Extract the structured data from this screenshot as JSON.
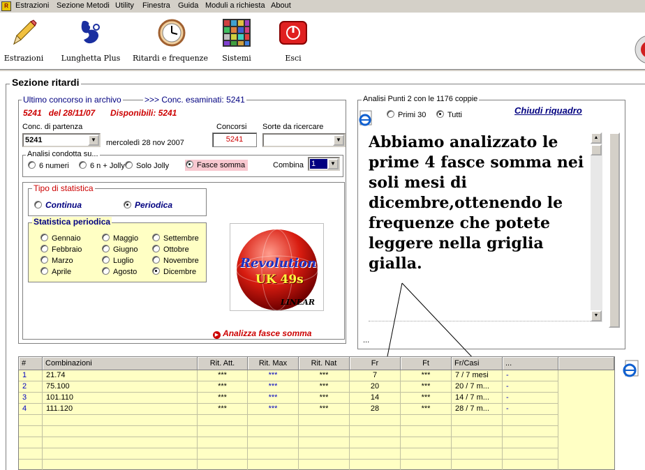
{
  "menu": [
    "Estrazioni",
    "Sezione Metodi",
    "Utility",
    "Finestra",
    "Guida",
    "Moduli a richiesta",
    "About"
  ],
  "toolbar": {
    "estrazioni": "Estrazioni",
    "lunghetta": "Lunghetta Plus",
    "ritardi": "Ritardi e frequenze",
    "sistemi": "Sistemi",
    "esci": "Esci"
  },
  "section_title": "Sezione ritardi",
  "archivio": {
    "title": "Ultimo concorso in archivo",
    "examined": ">>> Conc. esaminati: 5241",
    "last": "5241   del 28/11/07",
    "disponibili": "Disponibili: 5241",
    "conc_label": "Conc. di partenza",
    "conc_value": "5241",
    "conc_date": "mercoledì 28 nov 2007",
    "concorsi_label": "Concorsi",
    "concorsi_value": "5241",
    "sorte_label": "Sorte da ricercare",
    "sorte_value": ""
  },
  "analisi": {
    "title": "Analisi condotta su...",
    "options": [
      "6 numeri",
      "6 n + Jolly",
      "Solo Jolly",
      "Fasce somma"
    ],
    "selected_index": 3,
    "combina_label": "Combina",
    "combina_value": "1"
  },
  "tipo": {
    "title": "Tipo di statistica",
    "continua": "Continua",
    "periodica": "Periodica",
    "selected": "periodica"
  },
  "periodica": {
    "title": "Statistica periodica",
    "months": [
      "Gennaio",
      "Febbraio",
      "Marzo",
      "Aprile",
      "Maggio",
      "Giugno",
      "Luglio",
      "Agosto",
      "Settembre",
      "Ottobre",
      "Novembre",
      "Dicembre"
    ],
    "selected": "Dicembre"
  },
  "logo": {
    "line1": "Revolution",
    "line2": "UK 49s",
    "line3": "LINEAR"
  },
  "analizza_label": "Analizza fasce somma",
  "punti": {
    "title": "Analisi Punti 2 con le 1176 coppie",
    "primi": "Primi 30",
    "tutti": "Tutti",
    "selected": "tutti",
    "chiudi": "Chiudi riquadro",
    "message": "Abbiamo analizzato le prime 4 fasce somma nei soli mesi di dicembre,ottenendo le frequenze che potete leggere nella griglia gialla.",
    "ellipsis": "..."
  },
  "grid": {
    "headers": [
      "#",
      "Combinazioni",
      "Rit. Att.",
      "Rit. Max",
      "Rit. Nat",
      "Fr",
      "Ft",
      "Fr/Casi",
      "..."
    ],
    "rows": [
      [
        "1",
        "21.74",
        "***",
        "***",
        "***",
        "7",
        "***",
        "7 / 7 mesi",
        "-"
      ],
      [
        "2",
        "75.100",
        "***",
        "***",
        "***",
        "20",
        "***",
        "20 / 7 m...",
        "-"
      ],
      [
        "3",
        "101.110",
        "***",
        "***",
        "***",
        "14",
        "***",
        "14 / 7 m...",
        "-"
      ],
      [
        "4",
        "111.120",
        "***",
        "***",
        "***",
        "28",
        "***",
        "28 / 7 m...",
        "-"
      ]
    ]
  },
  "colors": {
    "accent_red": "#cc0000",
    "grid_yellow": "#ffffc4",
    "title_blue": "#000080"
  }
}
